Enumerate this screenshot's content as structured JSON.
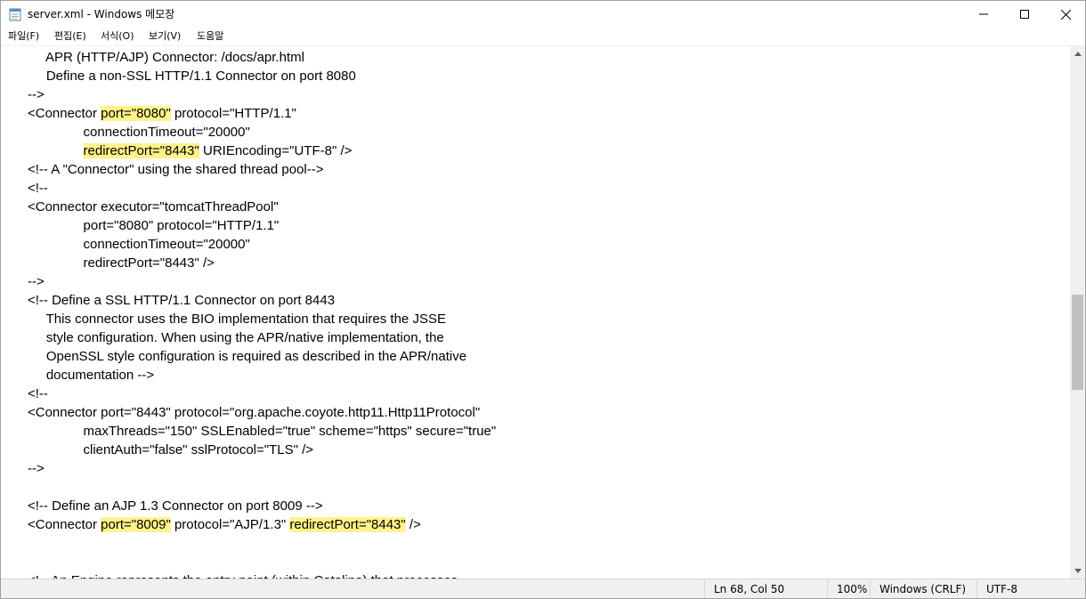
{
  "window": {
    "title": "server.xml - Windows 메모장",
    "icon": "notepad-icon"
  },
  "menu": {
    "items": [
      {
        "label": "파일(F)"
      },
      {
        "label": "편집(E)"
      },
      {
        "label": "서식(O)"
      },
      {
        "label": "보기(V)"
      },
      {
        "label": "도움말"
      }
    ]
  },
  "editor": {
    "lines": [
      [
        "     APR (HTTP/AJP) Connector: /docs/apr.html"
      ],
      [
        "     Define a non-SSL HTTP/1.1 Connector on port 8080"
      ],
      [
        "-->"
      ],
      [
        "<Connector ",
        {
          "hl": "port=\"8080\""
        },
        " protocol=\"HTTP/1.1\""
      ],
      [
        "               connectionTimeout=\"20000\""
      ],
      [
        "               ",
        {
          "hl": "redirectPort=\"8443\""
        },
        " URIEncoding=\"UTF-8\" />"
      ],
      [
        "<!-- A \"Connector\" using the shared thread pool-->"
      ],
      [
        "<!--"
      ],
      [
        "<Connector executor=\"tomcatThreadPool\""
      ],
      [
        "               port=\"8080\" protocol=\"HTTP/1.1\""
      ],
      [
        "               connectionTimeout=\"20000\""
      ],
      [
        "               redirectPort=\"8443\" />"
      ],
      [
        "-->"
      ],
      [
        "<!-- Define a SSL HTTP/1.1 Connector on port 8443"
      ],
      [
        "     This connector uses the BIO implementation that requires the JSSE"
      ],
      [
        "     style configuration. When using the APR/native implementation, the"
      ],
      [
        "     OpenSSL style configuration is required as described in the APR/native"
      ],
      [
        "     documentation -->"
      ],
      [
        "<!--"
      ],
      [
        "<Connector port=\"8443\" protocol=\"org.apache.coyote.http11.Http11Protocol\""
      ],
      [
        "               maxThreads=\"150\" SSLEnabled=\"true\" scheme=\"https\" secure=\"true\""
      ],
      [
        "               clientAuth=\"false\" sslProtocol=\"TLS\" />"
      ],
      [
        "-->"
      ],
      [
        ""
      ],
      [
        "<!-- Define an AJP 1.3 Connector on port 8009 -->"
      ],
      [
        "<Connector ",
        {
          "hl": "port=\"8009\""
        },
        " protocol=\"AJP/1.3\" ",
        {
          "hl": "redirectPort=\"8443\""
        },
        " />"
      ],
      [
        ""
      ],
      [
        ""
      ],
      [
        "<!-- An Engine represents the entry point (within Catalina) that processes"
      ]
    ]
  },
  "scrollbar": {
    "up_icon": "scroll-up-arrow-icon",
    "down_icon": "scroll-down-arrow-icon"
  },
  "status": {
    "position": "Ln 68, Col 50",
    "zoom": "100%",
    "line_ending": "Windows (CRLF)",
    "encoding": "UTF-8"
  },
  "colors": {
    "highlight": "#fff389",
    "statusbar": "#f0f0f0"
  }
}
